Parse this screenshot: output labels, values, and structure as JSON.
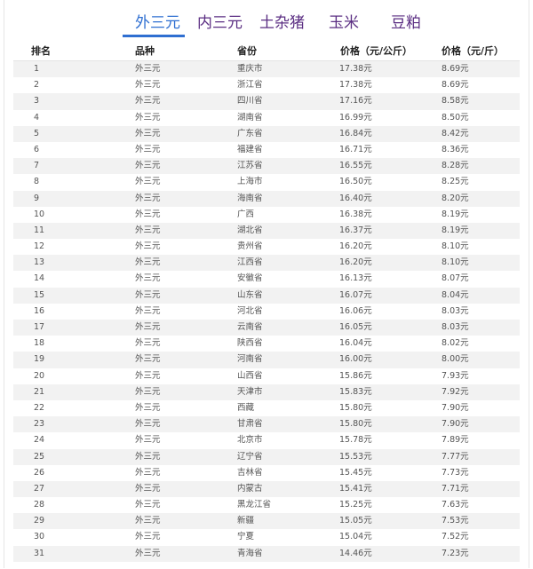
{
  "tabs": [
    {
      "label": "外三元",
      "active": true
    },
    {
      "label": "内三元",
      "active": false
    },
    {
      "label": "土杂猪",
      "active": false
    },
    {
      "label": "玉米",
      "active": false
    },
    {
      "label": "豆粕",
      "active": false
    }
  ],
  "colors": {
    "active_tab": "#2f6fd1",
    "inactive_tab": "#5a2d82",
    "row_stripe": "#f2f2f2"
  },
  "table": {
    "headers": [
      "排名",
      "品种",
      "省份",
      "价格（元/公斤）",
      "价格（元/斤）"
    ],
    "rows": [
      [
        "1",
        "外三元",
        "重庆市",
        "17.38元",
        "8.69元"
      ],
      [
        "2",
        "外三元",
        "浙江省",
        "17.38元",
        "8.69元"
      ],
      [
        "3",
        "外三元",
        "四川省",
        "17.16元",
        "8.58元"
      ],
      [
        "4",
        "外三元",
        "湖南省",
        "16.99元",
        "8.50元"
      ],
      [
        "5",
        "外三元",
        "广东省",
        "16.84元",
        "8.42元"
      ],
      [
        "6",
        "外三元",
        "福建省",
        "16.71元",
        "8.36元"
      ],
      [
        "7",
        "外三元",
        "江苏省",
        "16.55元",
        "8.28元"
      ],
      [
        "8",
        "外三元",
        "上海市",
        "16.50元",
        "8.25元"
      ],
      [
        "9",
        "外三元",
        "海南省",
        "16.40元",
        "8.20元"
      ],
      [
        "10",
        "外三元",
        "广西",
        "16.38元",
        "8.19元"
      ],
      [
        "11",
        "外三元",
        "湖北省",
        "16.37元",
        "8.19元"
      ],
      [
        "12",
        "外三元",
        "贵州省",
        "16.20元",
        "8.10元"
      ],
      [
        "13",
        "外三元",
        "江西省",
        "16.20元",
        "8.10元"
      ],
      [
        "14",
        "外三元",
        "安徽省",
        "16.13元",
        "8.07元"
      ],
      [
        "15",
        "外三元",
        "山东省",
        "16.07元",
        "8.04元"
      ],
      [
        "16",
        "外三元",
        "河北省",
        "16.06元",
        "8.03元"
      ],
      [
        "17",
        "外三元",
        "云南省",
        "16.05元",
        "8.03元"
      ],
      [
        "18",
        "外三元",
        "陕西省",
        "16.04元",
        "8.02元"
      ],
      [
        "19",
        "外三元",
        "河南省",
        "16.00元",
        "8.00元"
      ],
      [
        "20",
        "外三元",
        "山西省",
        "15.86元",
        "7.93元"
      ],
      [
        "21",
        "外三元",
        "天津市",
        "15.83元",
        "7.92元"
      ],
      [
        "22",
        "外三元",
        "西藏",
        "15.80元",
        "7.90元"
      ],
      [
        "23",
        "外三元",
        "甘肃省",
        "15.80元",
        "7.90元"
      ],
      [
        "24",
        "外三元",
        "北京市",
        "15.78元",
        "7.89元"
      ],
      [
        "25",
        "外三元",
        "辽宁省",
        "15.53元",
        "7.77元"
      ],
      [
        "26",
        "外三元",
        "吉林省",
        "15.45元",
        "7.73元"
      ],
      [
        "27",
        "外三元",
        "内蒙古",
        "15.41元",
        "7.71元"
      ],
      [
        "28",
        "外三元",
        "黑龙江省",
        "15.25元",
        "7.63元"
      ],
      [
        "29",
        "外三元",
        "新疆",
        "15.05元",
        "7.53元"
      ],
      [
        "30",
        "外三元",
        "宁夏",
        "15.04元",
        "7.52元"
      ],
      [
        "31",
        "外三元",
        "青海省",
        "14.46元",
        "7.23元"
      ]
    ]
  }
}
